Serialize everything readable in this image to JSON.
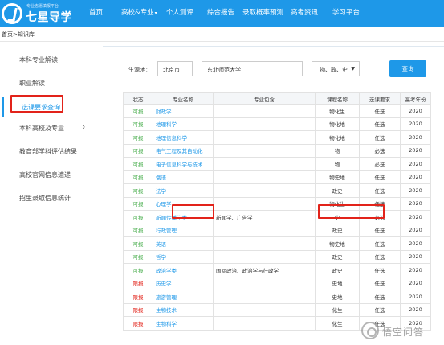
{
  "header": {
    "logo_sub": "专业志愿填报平台",
    "logo_text": "七星导学",
    "nav": [
      "首页",
      "高校&专业",
      "个人测评",
      "综合报告",
      "录取概率预测",
      "高考资讯",
      "学习平台"
    ],
    "nav_caret": "▾"
  },
  "breadcrumb": "首页>知识库",
  "sidebar": {
    "items": [
      {
        "label": "本科专业解读"
      },
      {
        "label": "职业解读"
      },
      {
        "label": "选课要求查询"
      },
      {
        "label": "本科高校及专业"
      },
      {
        "label": "教育部学科评估结果"
      },
      {
        "label": "高校官网信息速递"
      },
      {
        "label": "招生录取信息统计"
      }
    ],
    "chevron": "›"
  },
  "filters": {
    "origin_label": "生源地：",
    "origin_value": "北京市",
    "school_value": "东北师范大学",
    "subjects_value": "物、政、史",
    "query_button": "查询"
  },
  "table": {
    "headers": [
      "状态",
      "专业名称",
      "专业包含",
      "课程名称",
      "选课要求",
      "高考年份"
    ],
    "rows": [
      {
        "status": "可报",
        "major": "财政学",
        "cover": "",
        "course": "物化生",
        "req": "任选",
        "year": "2020"
      },
      {
        "status": "可报",
        "major": "地理科学",
        "cover": "",
        "course": "物化地",
        "req": "任选",
        "year": "2020"
      },
      {
        "status": "可报",
        "major": "地理信息科学",
        "cover": "",
        "course": "物化地",
        "req": "任选",
        "year": "2020"
      },
      {
        "status": "可报",
        "major": "电气工程及其自动化",
        "cover": "",
        "course": "物",
        "req": "必选",
        "year": "2020"
      },
      {
        "status": "可报",
        "major": "电子信息科学与技术",
        "cover": "",
        "course": "物",
        "req": "必选",
        "year": "2020"
      },
      {
        "status": "可报",
        "major": "俄语",
        "cover": "",
        "course": "物史地",
        "req": "任选",
        "year": "2020"
      },
      {
        "status": "可报",
        "major": "法学",
        "cover": "",
        "course": "政史",
        "req": "任选",
        "year": "2020"
      },
      {
        "status": "可报",
        "major": "心理学",
        "cover": "",
        "course": "物化生",
        "req": "任选",
        "year": "2020"
      },
      {
        "status": "可报",
        "major": "新闻传播学类",
        "cover": "新闻学、广告学",
        "course": "史",
        "req": "必选",
        "year": "2020"
      },
      {
        "status": "可报",
        "major": "行政管理",
        "cover": "",
        "course": "政史",
        "req": "任选",
        "year": "2020"
      },
      {
        "status": "可报",
        "major": "英语",
        "cover": "",
        "course": "物史地",
        "req": "任选",
        "year": "2020"
      },
      {
        "status": "可报",
        "major": "哲学",
        "cover": "",
        "course": "政史",
        "req": "任选",
        "year": "2020"
      },
      {
        "status": "可报",
        "major": "政治学类",
        "cover": "国际政治、政治学与行政学",
        "course": "政史",
        "req": "任选",
        "year": "2020"
      },
      {
        "status": "限报",
        "major": "历史学",
        "cover": "",
        "course": "史地",
        "req": "任选",
        "year": "2020"
      },
      {
        "status": "限报",
        "major": "旅游管理",
        "cover": "",
        "course": "史地",
        "req": "任选",
        "year": "2020"
      },
      {
        "status": "限报",
        "major": "生物技术",
        "cover": "",
        "course": "化生",
        "req": "任选",
        "year": "2020"
      },
      {
        "status": "限报",
        "major": "生物科学",
        "cover": "",
        "course": "化生",
        "req": "任选",
        "year": "2020"
      }
    ]
  },
  "watermark": {
    "text": "悟空问答"
  },
  "colors": {
    "primary": "#1e98e8",
    "highlight": "#e2231a",
    "ok": "#4caf50",
    "limited": "#e2231a"
  }
}
